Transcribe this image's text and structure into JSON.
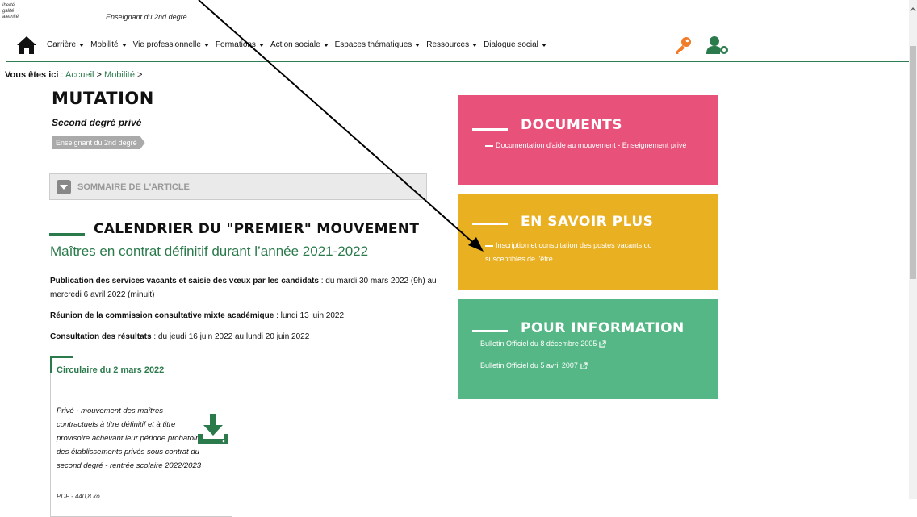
{
  "header": {
    "logo_lines": [
      "iberté",
      "galité",
      "aternité"
    ],
    "site_subtitle": "Enseignant du 2nd degré"
  },
  "nav": {
    "items": [
      {
        "label": "Carrière"
      },
      {
        "label": "Mobilité"
      },
      {
        "label": "Vie professionnelle"
      },
      {
        "label": "Formations"
      },
      {
        "label": "Action sociale"
      },
      {
        "label": "Espaces thématiques"
      },
      {
        "label": "Ressources"
      },
      {
        "label": "Dialogue social"
      }
    ],
    "icons": [
      "home-icon",
      "key-icon",
      "user-gear-icon"
    ]
  },
  "breadcrumb": {
    "label": "Vous êtes ici",
    "sep": " : ",
    "items": [
      "Accueil",
      "Mobilité"
    ],
    "arrow": ">"
  },
  "article": {
    "title": "MUTATION",
    "subtitle": "Second degré privé",
    "tag": "Enseignant du 2nd degré",
    "sommaire": "SOMMAIRE DE L'ARTICLE",
    "section_title": "CALENDRIER DU \"PREMIER\" MOUVEMENT",
    "section_subtitle": "Maîtres en contrat définitif durant l’année 2021-2022",
    "p1_bold": "Publication des services vacants et saisie des vœux par les candidats",
    "p1_rest": " : du mardi 30 mars 2022 (9h) au mercredi 6 avril 2022 (minuit)",
    "p2_bold": "Réunion de la commission consultative mixte académique",
    "p2_rest": " : lundi 13 juin 2022",
    "p3_bold": "Consultation des résultats",
    "p3_rest": " : du jeudi 16 juin 2022 au lundi 20 juin 2022"
  },
  "card": {
    "title": "Circulaire du 2 mars 2022",
    "description": "Privé - mouvement des maîtres contractuels à titre définitif et à titre provisoire achevant leur période probatoire des établissements privés sous contrat du second degré - rentrée scolaire 2022/2023",
    "file_info": "PDF - 440,8 ko"
  },
  "boxes": {
    "documents": {
      "title": "DOCUMENTS",
      "link": "Documentation d'aide au mouvement - Enseignement privé",
      "color": "#e8527a"
    },
    "en_savoir_plus": {
      "title": "EN SAVOIR PLUS",
      "link": "Inscription et consultation des postes vacants ou susceptibles de l'être",
      "color": "#e9b021"
    },
    "pour_information": {
      "title": "POUR INFORMATION",
      "links": [
        "Bulletin Officiel du 8 décembre 2005",
        "Bulletin Officiel du 5 avril 2007"
      ],
      "color": "#55b785"
    }
  },
  "colors": {
    "accent_green": "#2a7a4b",
    "arrow": "#000000"
  }
}
